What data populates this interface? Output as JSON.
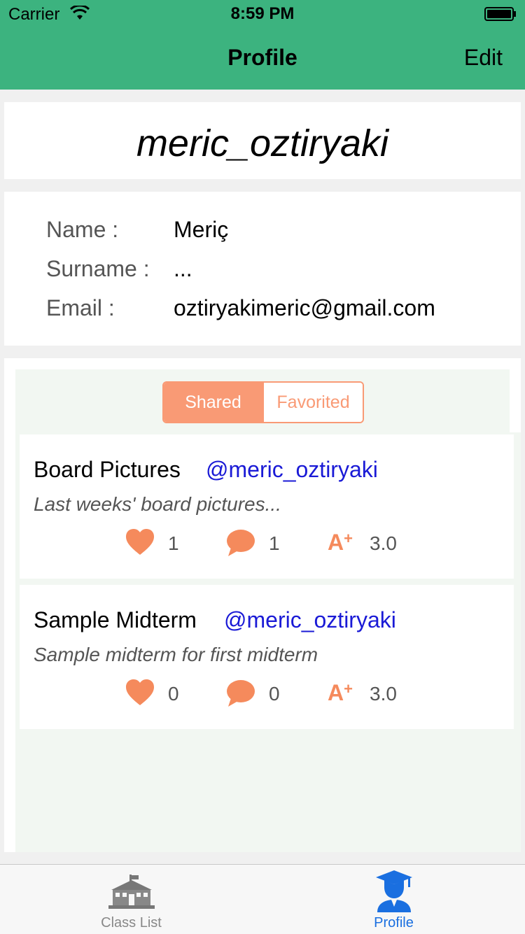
{
  "status": {
    "carrier": "Carrier",
    "time": "8:59 PM"
  },
  "nav": {
    "title": "Profile",
    "edit_label": "Edit"
  },
  "profile": {
    "username": "meric_oztiryaki",
    "fields": [
      {
        "label": "Name :",
        "value": "Meriç"
      },
      {
        "label": "Surname :",
        "value": "..."
      },
      {
        "label": "Email :",
        "value": "oztiryakimeric@gmail.com"
      }
    ]
  },
  "segment": {
    "options": [
      "Shared",
      "Favorited"
    ],
    "selected": "Shared"
  },
  "posts": [
    {
      "title": "Board Pictures",
      "user": "@meric_oztiryaki",
      "description": "Last weeks' board pictures...",
      "likes": "1",
      "comments": "1",
      "grade": "3.0"
    },
    {
      "title": "Sample Midterm",
      "user": "@meric_oztiryaki",
      "description": "Sample midterm for first midterm",
      "likes": "0",
      "comments": "0",
      "grade": "3.0"
    }
  ],
  "tabbar": {
    "tabs": [
      {
        "label": "Class List",
        "icon": "school-building-icon",
        "active": false
      },
      {
        "label": "Profile",
        "icon": "graduate-student-icon",
        "active": true
      }
    ]
  },
  "colors": {
    "nav_green": "#3cb37f",
    "accent_orange": "#f99a75",
    "link_blue": "#1a1ad6",
    "active_tab_blue": "#1a6fe0"
  }
}
